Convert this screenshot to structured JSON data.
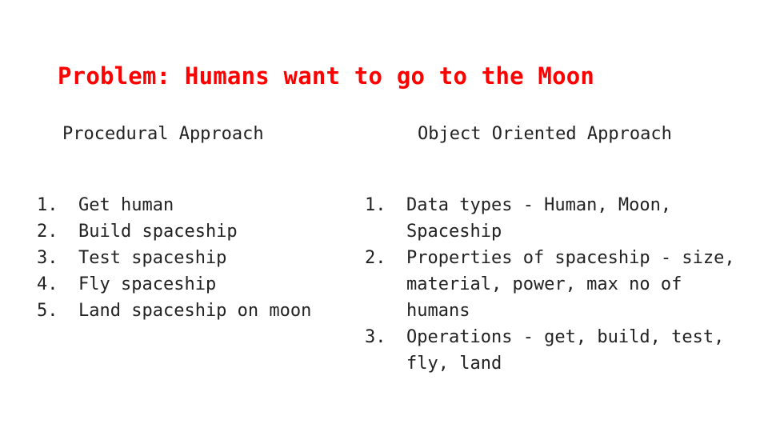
{
  "slide": {
    "title": "Problem: Humans want to go to the Moon"
  },
  "procedural": {
    "heading": "Procedural Approach",
    "items": [
      {
        "num": "1.",
        "text": "Get human"
      },
      {
        "num": "2.",
        "text": "Build spaceship"
      },
      {
        "num": "3.",
        "text": "Test spaceship"
      },
      {
        "num": "4.",
        "text": "Fly spaceship"
      },
      {
        "num": "5.",
        "text": "Land spaceship on moon"
      }
    ]
  },
  "object_oriented": {
    "heading": "Object Oriented Approach",
    "items": [
      {
        "num": "1.",
        "text": "Data types - Human, Moon, Spaceship"
      },
      {
        "num": "2.",
        "text": "Properties of spaceship - size, material, power, max no of humans"
      },
      {
        "num": "3.",
        "text": "Operations - get, build, test, fly, land"
      }
    ]
  }
}
